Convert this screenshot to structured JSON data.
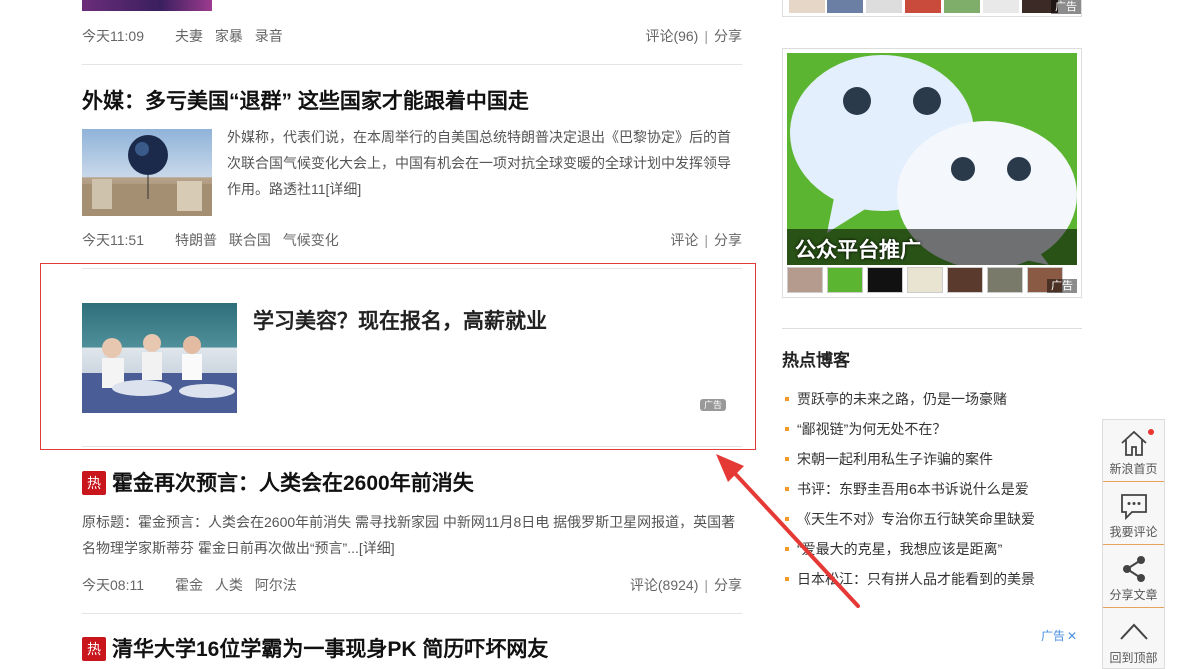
{
  "feed": {
    "article1": {
      "time": "今天11:09",
      "tags": [
        "夫妻",
        "家暴",
        "录音"
      ],
      "comments": "评论(96)",
      "share": "分享",
      "separator": "|"
    },
    "article2": {
      "title": "外媒：多亏美国“退群” 这些国家才能跟着中国走",
      "summary": "外媒称，代表们说，在本周举行的自美国总统特朗普决定退出《巴黎协定》后的首次联合国气候变化大会上，中国有机会在一项对抗全球变暖的全球计划中发挥领导作用。路透社11",
      "more": "[详细]",
      "time": "今天11:51",
      "tags": [
        "特朗普",
        "联合国",
        "气候变化"
      ],
      "comments": "评论",
      "share": "分享",
      "separator": "|"
    },
    "ad": {
      "title": "学习美容？现在报名，高薪就业",
      "badge": "广告"
    },
    "article3": {
      "hot": "热",
      "title": "霍金再次预言：人类会在2600年前消失",
      "summary": "原标题：霍金预言：人类会在2600年前消失 需寻找新家园 中新网11月8日电 据俄罗斯卫星网报道，英国著名物理学家斯蒂芬 霍金日前再次做出“预言”...",
      "more": "[详细]",
      "time": "今天08:11",
      "tags": [
        "霍金",
        "人类",
        "阿尔法"
      ],
      "comments": "评论(8924)",
      "share": "分享",
      "separator": "|"
    },
    "article4": {
      "hot": "热",
      "title": "清华大学16位学霸为一事现身PK 简历吓坏网友"
    }
  },
  "sidebar": {
    "top_ad_tag": "广告",
    "promo": {
      "text": "公众平台推广",
      "ad_tag": "广告"
    },
    "hot_blogs": {
      "heading": "热点博客",
      "items": [
        "贾跃亭的未来之路，仍是一场豪赌",
        "“鄙视链”为何无处不在？",
        "宋朝一起利用私生子诈骗的案件",
        "书评：东野圭吾用6本书诉说什么是爱",
        "《天生不对》专治你五行缺笑命里缺爱",
        "“爱最大的克星，我想应该是距离”",
        "日本松江：只有拼人品才能看到的美景"
      ]
    },
    "ad_close": {
      "label": "广告",
      "close": "✕"
    }
  },
  "float_bar": {
    "home": "新浪首页",
    "comment": "我要评论",
    "share": "分享文章",
    "top": "回到顶部"
  },
  "colors": {
    "hot_red": "#c9161d",
    "ad_frame": "#e03a3a",
    "bullet": "#f29a25",
    "wechat_green": "#5cb531"
  }
}
